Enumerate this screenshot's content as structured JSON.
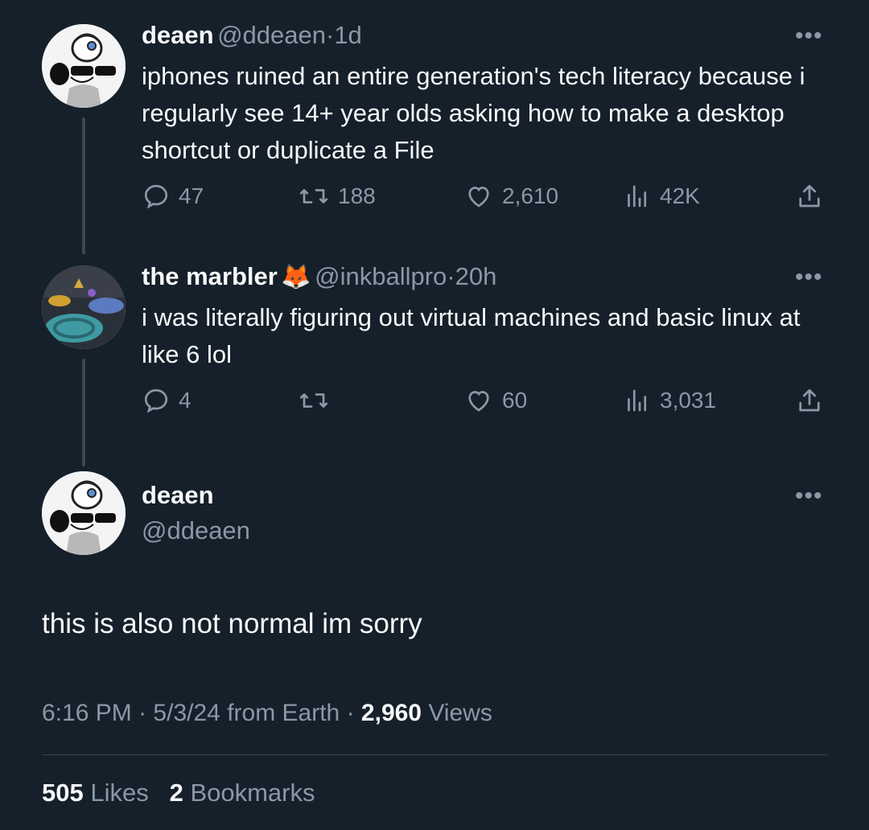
{
  "tweet1": {
    "display_name": "deaen",
    "handle": "@ddeaen",
    "separator": "·",
    "time": "1d",
    "text": "iphones ruined an entire generation's tech literacy because i regularly see 14+ year olds asking how to make a desktop shortcut or duplicate a File",
    "replies": "47",
    "retweets": "188",
    "likes": "2,610",
    "views": "42K",
    "avatar_icon": "avatar-cartoon-sunglasses"
  },
  "tweet2": {
    "display_name": "the marbler",
    "emoji": "🦊",
    "handle": "@inkballpro",
    "separator": "·",
    "time": "20h",
    "text": "i was literally figuring out virtual machines and basic linux at like 6 lol",
    "replies": "4",
    "retweets": "",
    "likes": "60",
    "views": "3,031",
    "avatar_icon": "avatar-inkball-game"
  },
  "main": {
    "display_name": "deaen",
    "handle": "@ddeaen",
    "text": "this is also not normal im sorry",
    "time": "6:16 PM",
    "sep": "·",
    "date": "5/3/24",
    "source": "from Earth",
    "views_count": "2,960",
    "views_label": "Views",
    "likes_count": "505",
    "likes_label": "Likes",
    "bookmarks_count": "2",
    "bookmarks_label": "Bookmarks"
  },
  "colors": {
    "background": "#15202b",
    "primary_text": "#f7f9f9",
    "secondary_text": "#8b98a5",
    "thread_line": "#3b4754"
  }
}
